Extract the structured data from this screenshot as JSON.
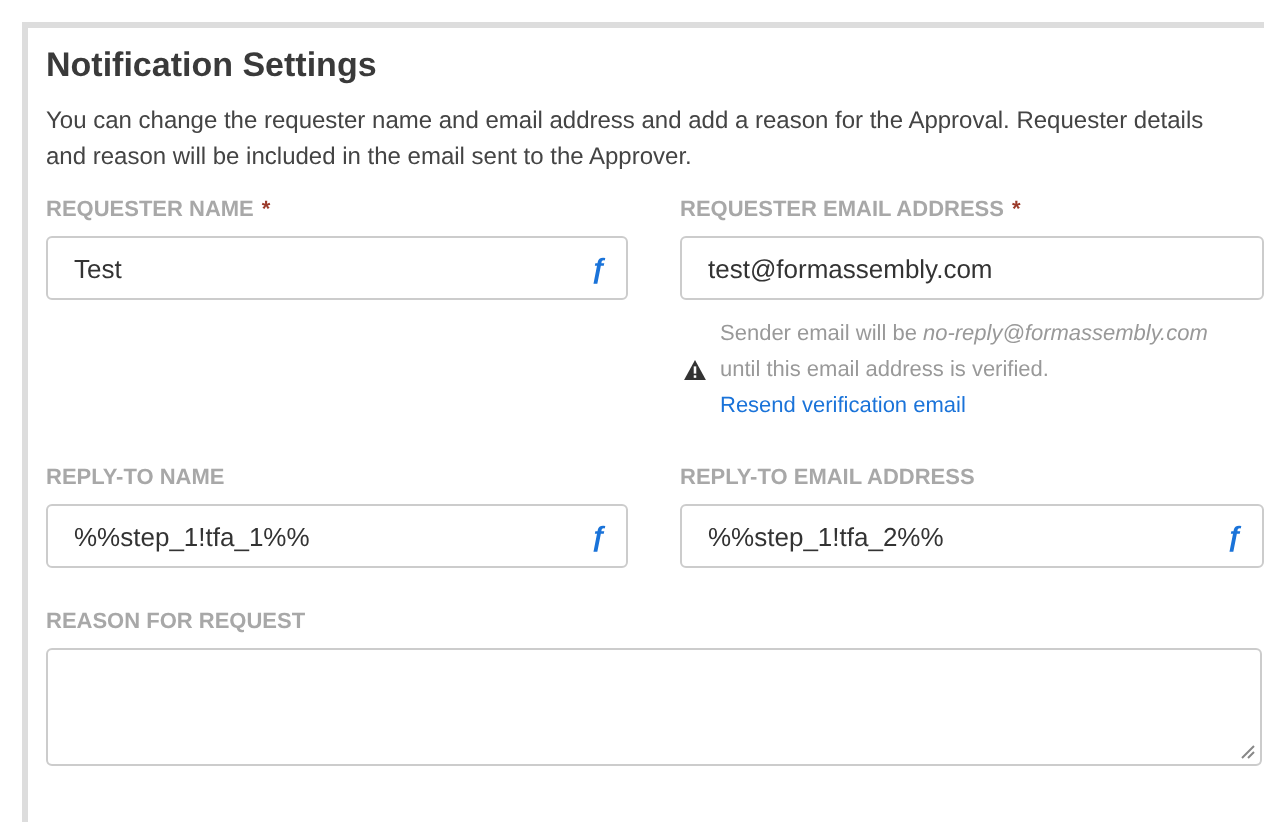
{
  "panel": {
    "title": "Notification Settings",
    "description": "You can change the requester name and email address and add a reason for the Approval. Requester details and reason will be included in the email sent to the Approver."
  },
  "fields": [
    {
      "label": "REQUESTER NAME",
      "required_mark": "*",
      "value": "Test",
      "formula_button": "ƒ"
    },
    {
      "label": "REQUESTER EMAIL ADDRESS",
      "required_mark": "*",
      "value": "test@formassembly.com",
      "note": {
        "text": "Sender email will be *no-reply@formassembly.com*   until this email address is verified.",
        "link": "Resend verification email"
      }
    },
    {
      "label": "REPLY-TO NAME",
      "value": "%%step_1!tfa_1%%",
      "formula_button": "ƒ"
    },
    {
      "label": "REPLY-TO EMAIL ADDRESS",
      "value": "%%step_1!tfa_2%%",
      "formula_button": "ƒ"
    }
  ],
  "reason": {
    "label": "REASON FOR REQUEST"
  }
}
